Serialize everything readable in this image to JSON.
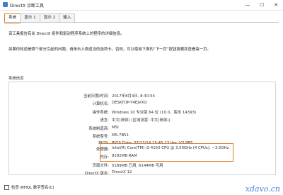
{
  "window": {
    "title": "DirectX 诊断工具",
    "controls": [
      "—",
      "☐",
      "✕"
    ]
  },
  "tabs": [
    "系统",
    "显示 1",
    "显示 2",
    "输入"
  ],
  "intro": {
    "line1": "该工具报告有关 DirectX 组件和驱动程序系统上的程序的详细信息。",
    "line2": "如果你知道是哪个部分引起的问题，请单击上面适当的选项卡。否则，可以使用下面的“下一页”按钮按顺序查看每一页。"
  },
  "system_info": {
    "legend": "系统信息",
    "rows": [
      {
        "label": "当前日期/时间:",
        "value": "2017年8月4日, 8:30:54"
      },
      {
        "label": "计算机名:",
        "value": "DESKTOP-T4EJVXQ"
      },
      {
        "label": "操作系统:",
        "value": "Windows 10 专业版 64 位 (10.0，版本 14393)"
      },
      {
        "label": "语言:",
        "value": "中文(简体) (区域设置: 中文(简体))"
      },
      {
        "label": "系统制造商:",
        "value": "MSI"
      },
      {
        "label": "系统型号:",
        "value": "MS-7B51"
      },
      {
        "label": "BIOS:",
        "value": "BIOS Date: 07/17/14 15:45:13 Ver: V3.8B5"
      },
      {
        "label": "处理器:",
        "value": "Intel(R) Core(TM) i3-4150 CPU @ 3.50GHz (4 CPUs), ~3.5GHz"
      },
      {
        "label": "内存:",
        "value": "8192MB RAM"
      },
      {
        "label": "页面文件:",
        "value": "5189MB 已用, 6144MB 可用"
      },
      {
        "label": "DirectX 版本:",
        "value": "DirectX 12"
      }
    ]
  },
  "checkbox": {
    "label": "检查 WHQL 数字签名(C)",
    "checked": false
  },
  "watermark": "xdavo.cn",
  "colors": {
    "highlight": "#e07b22",
    "icon": "#3b7fd6",
    "watermark": "#2b6bd6"
  }
}
